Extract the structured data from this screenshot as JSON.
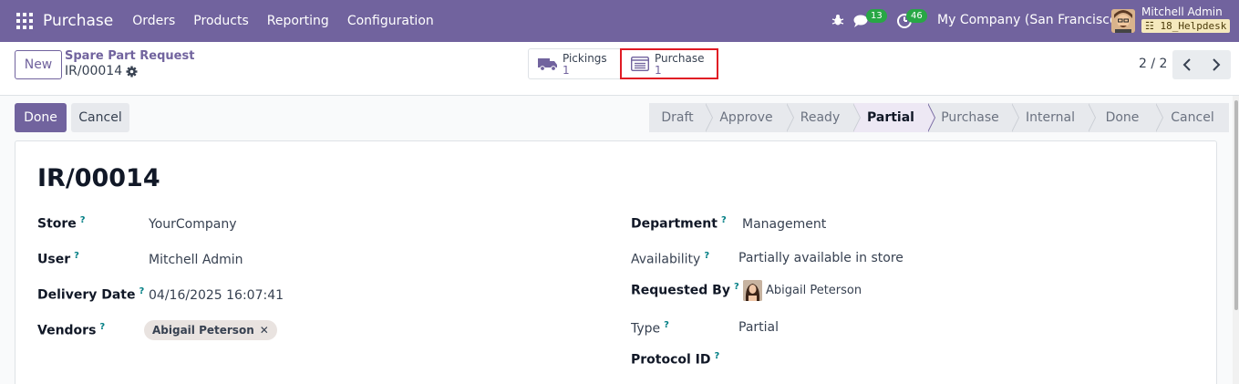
{
  "navbar": {
    "app_name": "Purchase",
    "menu": [
      "Orders",
      "Products",
      "Reporting",
      "Configuration"
    ],
    "messages_count": "13",
    "activities_count": "46",
    "company": "My Company (San Francisco)",
    "user_name": "Mitchell Admin",
    "database": "18_Helpdesk",
    "bar_color": "#71639e"
  },
  "control": {
    "new_label": "New",
    "breadcrumb_parent": "Spare Part Request",
    "breadcrumb_current": "IR/00014",
    "smart_buttons": {
      "pickings": {
        "label": "Pickings",
        "value": "1"
      },
      "purchase": {
        "label": "Purchase",
        "value": "1"
      }
    },
    "pager": "2 / 2"
  },
  "actions": {
    "done_label": "Done",
    "cancel_label": "Cancel"
  },
  "statusbar": {
    "stages": [
      "Draft",
      "Approve",
      "Ready",
      "Partial",
      "Purchase",
      "Internal",
      "Done",
      "Cancel"
    ],
    "active": "Partial"
  },
  "form": {
    "title": "IR/00014",
    "left": {
      "store_label": "Store",
      "store_value": "YourCompany",
      "user_label": "User",
      "user_value": "Mitchell Admin",
      "delivery_label": "Delivery Date",
      "delivery_value": "04/16/2025 16:07:41",
      "vendors_label": "Vendors",
      "vendor_tag": "Abigail Peterson"
    },
    "right": {
      "department_label": "Department",
      "department_value": "Management",
      "availability_label": "Availability",
      "availability_value": "Partially available in store",
      "requested_label": "Requested By",
      "requested_value": "Abigail Peterson",
      "type_label": "Type",
      "type_value": "Partial",
      "protocol_label": "Protocol ID",
      "protocol_value": ""
    },
    "help_mark": "?"
  }
}
